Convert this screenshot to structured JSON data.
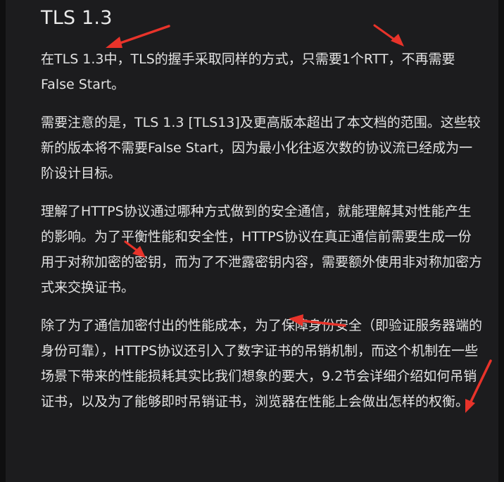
{
  "heading": "TLS 1.3",
  "paragraphs": [
    "在TLS 1.3中，TLS的握手采取同样的方式，只需要1个RTT，不再需要False Start。",
    "需要注意的是，TLS 1.3 [TLS13]及更高版本超出了本文档的范围。这些较新的版本将不需要False Start，因为最小化往返次数的协议流已经成为一阶设计目标。",
    "理解了HTTPS协议通过哪种方式做到的安全通信，就能理解其对性能产生的影响。为了平衡性能和安全性，HTTPS协议在真正通信前需要生成一份用于对称加密的密钥，而为了不泄露密钥内容，需要额外使用非对称加密方式来交换证书。",
    "除了为了通信加密付出的性能成本，为了保障身份安全（即验证服务器端的身份可靠），HTTPS协议还引入了数字证书的吊销机制，而这个机制在一些场景下带来的性能损耗其实比我们想象的要大，9.2节会详细介绍如何吊销证书，以及为了能够即时吊销证书，浏览器在性能上会做出怎样的权衡。"
  ],
  "colors": {
    "background": "#1c1c1e",
    "text": "#e2e2e2",
    "annotation_arrow": "#e8332a"
  }
}
